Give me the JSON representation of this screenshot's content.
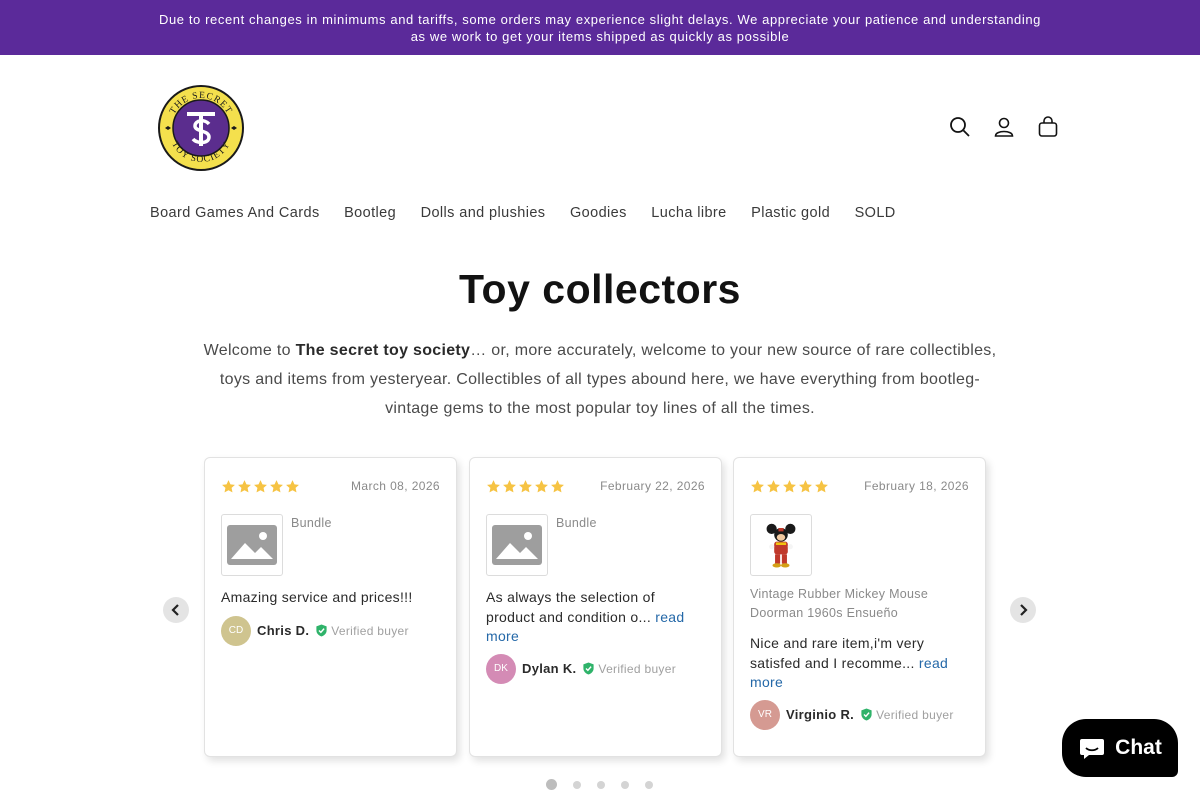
{
  "announcement": {
    "text": "Due to recent changes in minimums and tariffs, some orders may experience slight delays. We appreciate your patience and understanding as we work to get your items shipped as quickly as possible"
  },
  "brand": {
    "logo_top_text": "THE SECRET",
    "logo_bottom_text": "TOY SOCIETY",
    "logo_colors": {
      "ring": "#f4e04d",
      "center": "#5b2d8e",
      "outline": "#1a1a1a"
    }
  },
  "header_icons": [
    "search-icon",
    "account-icon",
    "cart-icon"
  ],
  "nav": {
    "items": [
      "Board Games And Cards",
      "Bootleg",
      "Dolls and plushies",
      "Goodies",
      "Lucha libre",
      "Plastic gold",
      "SOLD"
    ]
  },
  "main": {
    "title": "Toy collectors",
    "intro_prefix": "Welcome to ",
    "intro_bold": "The secret toy society",
    "intro_suffix": "… or, more accurately, welcome to your new source of rare collectibles, toys and items from yesteryear. Collectibles of all types abound here, we have everything from bootleg-vintage gems to the most popular toy lines of all the times."
  },
  "reviews": {
    "verified_label": "Verified buyer",
    "read_more_label": "read more",
    "items": [
      {
        "rating": 5,
        "date": "March 08, 2026",
        "product": "Bundle",
        "text": "Amazing service and prices!!!",
        "reviewer": "Chris D.",
        "initials": "CD",
        "avatar_color": "#cfc48f"
      },
      {
        "rating": 5,
        "date": "February 22, 2026",
        "product": "Bundle",
        "text": "As always the selection of product and condition o...",
        "reviewer": "Dylan K.",
        "initials": "DK",
        "avatar_color": "#d48bb5"
      },
      {
        "rating": 5,
        "date": "February 18, 2026",
        "product": "Vintage Rubber Mickey Mouse Doorman 1960s Ensueño",
        "text": "Nice and rare item,i'm very satisfed and I recomme...",
        "reviewer": "Virginio R.",
        "initials": "VR",
        "avatar_color": "#d59a92"
      }
    ],
    "pagination": {
      "total": 5,
      "active": 1
    }
  },
  "chat": {
    "label": "Chat",
    "background": "#000000"
  },
  "colors": {
    "announcement_bg": "#5b2a9a",
    "star": "#f6c343",
    "verified": "#2fb36a",
    "link": "#2468a8"
  }
}
